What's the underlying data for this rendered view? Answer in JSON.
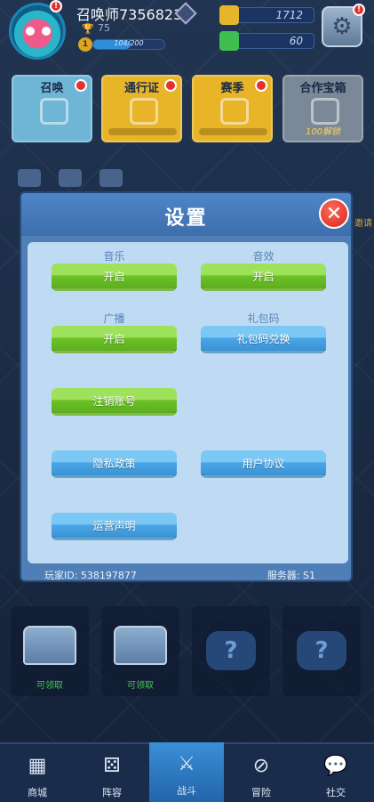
{
  "player": {
    "name": "召唤师7356823",
    "trophies": "75",
    "level": "1",
    "xp_text": "104/200",
    "xp_fraction": 0.52
  },
  "resources": {
    "gold": "1712",
    "gems": "60"
  },
  "features": [
    {
      "label": "召唤",
      "color": "#6fb6d6"
    },
    {
      "label": "通行证",
      "color": "#e8b529"
    },
    {
      "label": "赛季",
      "color": "#e8b529"
    },
    {
      "label": "合作宝箱",
      "color": "#7b8898",
      "unlock": "100解锁"
    }
  ],
  "edge_text": "邀请",
  "settings": {
    "title": "设置",
    "music_label": "音乐",
    "music_button": "开启",
    "sfx_label": "音效",
    "sfx_button": "开启",
    "broadcast_label": "广播",
    "broadcast_button": "开启",
    "gift_label": "礼包码",
    "gift_button": "礼包码兑换",
    "logout_button": "注销账号",
    "privacy_button": "隐私政策",
    "agreement_button": "用户协议",
    "statement_button": "运营声明",
    "player_id": "玩家ID: 538197877",
    "server": "服务器: S1"
  },
  "slots": [
    {
      "label": "可领取"
    },
    {
      "label": "可领取"
    },
    {
      "symbol": "?"
    },
    {
      "symbol": "?"
    }
  ],
  "nav": [
    {
      "label": "商城",
      "icon": "shop-icon"
    },
    {
      "label": "阵容",
      "icon": "dice-icon"
    },
    {
      "label": "战斗",
      "icon": "crossed-swords-icon"
    },
    {
      "label": "冒险",
      "icon": "compass-icon"
    },
    {
      "label": "社交",
      "icon": "chat-icon"
    }
  ]
}
